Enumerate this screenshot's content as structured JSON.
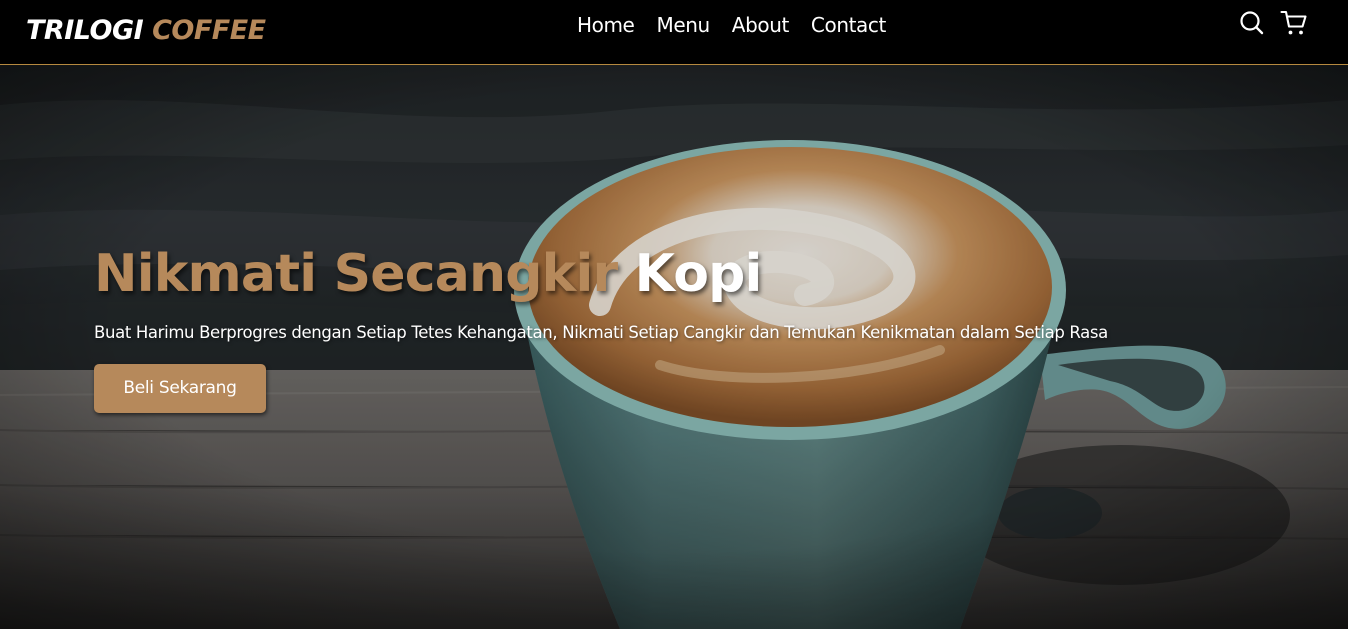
{
  "brand": {
    "logo_part1": "TRILOGI",
    "logo_part2": "COFFEE"
  },
  "nav": {
    "links": [
      {
        "label": "Home"
      },
      {
        "label": "Menu"
      },
      {
        "label": "About"
      },
      {
        "label": "Contact"
      }
    ],
    "icons": [
      "search-icon",
      "shopping-cart-icon"
    ]
  },
  "hero": {
    "title_part1": "Nikmati Secangkir",
    "title_part2": "Kopi",
    "subtitle": "Buat Harimu Berprogres dengan Setiap Tetes Kehangatan, Nikmati Setiap Cangkir dan Temukan Kenikmatan dalam Setiap Rasa",
    "cta_label": "Beli Sekarang"
  },
  "colors": {
    "accent": "#b6895b",
    "nav_border": "#b6893f",
    "text": "#ffffff",
    "navbar_bg": "#000000"
  }
}
